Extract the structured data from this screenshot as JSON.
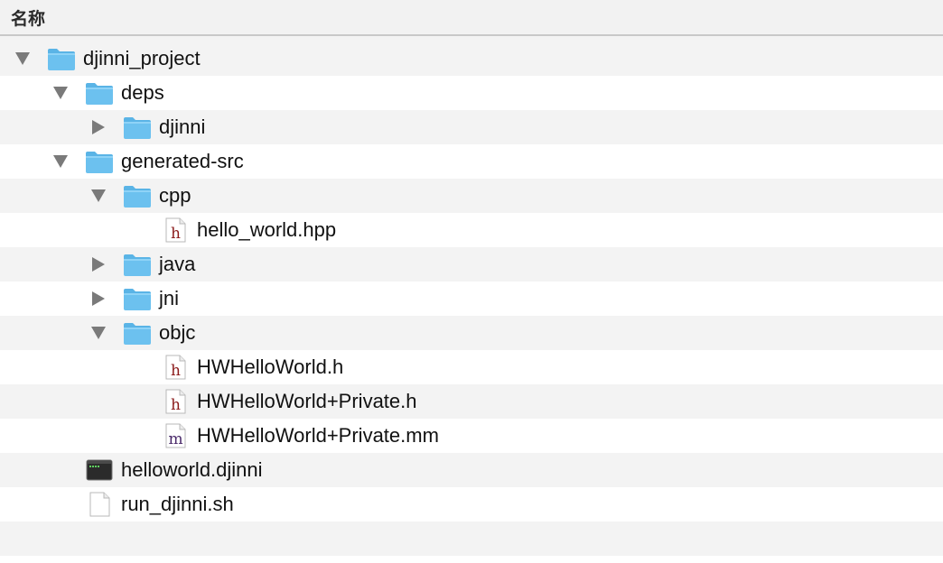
{
  "header": {
    "name_column": "名称"
  },
  "rows": [
    {
      "label": "djinni_project",
      "icon": "folder-icon",
      "disclosure": "expanded"
    },
    {
      "label": "deps",
      "icon": "folder-icon",
      "disclosure": "expanded"
    },
    {
      "label": "djinni",
      "icon": "folder-icon",
      "disclosure": "collapsed"
    },
    {
      "label": "generated-src",
      "icon": "folder-icon",
      "disclosure": "expanded"
    },
    {
      "label": "cpp",
      "icon": "folder-icon",
      "disclosure": "expanded"
    },
    {
      "label": "hello_world.hpp",
      "icon": "header-file-icon",
      "disclosure": "none",
      "glyph": "h"
    },
    {
      "label": "java",
      "icon": "folder-icon",
      "disclosure": "collapsed"
    },
    {
      "label": "jni",
      "icon": "folder-icon",
      "disclosure": "collapsed"
    },
    {
      "label": "objc",
      "icon": "folder-icon",
      "disclosure": "expanded"
    },
    {
      "label": "HWHelloWorld.h",
      "icon": "header-file-icon",
      "disclosure": "none",
      "glyph": "h"
    },
    {
      "label": "HWHelloWorld+Private.h",
      "icon": "header-file-icon",
      "disclosure": "none",
      "glyph": "h"
    },
    {
      "label": "HWHelloWorld+Private.mm",
      "icon": "objc-source-file-icon",
      "disclosure": "none",
      "glyph": "m"
    },
    {
      "label": "helloworld.djinni",
      "icon": "terminal-file-icon",
      "disclosure": "none"
    },
    {
      "label": "run_djinni.sh",
      "icon": "blank-file-icon",
      "disclosure": "none"
    }
  ],
  "colors": {
    "folder": "#6cc1ef",
    "folder_tab": "#5ab4e6",
    "header_glyph": "#8b1a1a",
    "source_glyph": "#4a2a6a",
    "row_stripe": "#f3f3f3",
    "row_plain": "#ffffff"
  }
}
